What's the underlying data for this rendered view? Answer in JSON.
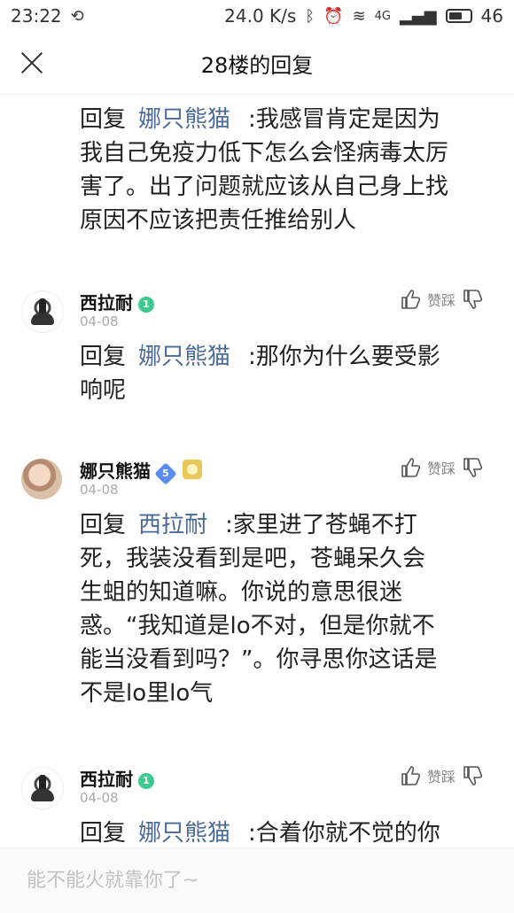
{
  "status_bar": {
    "time": "23:22",
    "speed": "24.0 K/s",
    "signal": "4G",
    "battery": "46"
  },
  "header": {
    "title": "28楼的回复"
  },
  "vote_label": "赞踩",
  "reply_prefix": "回复",
  "comments": [
    {
      "mention": "娜只熊猫",
      "text_lines": [
        ":我感冒肯定是因为",
        "我自己免疫力低下怎么会怪病毒太厉",
        "害了。出了问题就应该从自己身上找",
        "原因不应该把责任推给别人"
      ]
    },
    {
      "user": "西拉耐",
      "level": "1",
      "date": "04-08",
      "mention": "娜只熊猫",
      "text_lines": [
        ":那你为什么要受影",
        "响呢"
      ]
    },
    {
      "user": "娜只熊猫",
      "level": "5",
      "date": "04-08",
      "mention": "西拉耐",
      "text_lines": [
        ":家里进了苍蝇不打",
        "死，我装没看到是吧，苍蝇呆久会",
        "生蛆的知道嘛。你说的意思很迷",
        "惑。“我知道是lo不对，但是你就不",
        "能当没看到吗？”。你寻思你这话是",
        "不是lo里lo气"
      ]
    },
    {
      "user": "西拉耐",
      "level": "1",
      "date": "04-08",
      "mention": "娜只熊猫",
      "text_lines": [
        ":合着你就不觉的你"
      ]
    }
  ],
  "input": {
    "placeholder": "能不能火就靠你了~"
  }
}
